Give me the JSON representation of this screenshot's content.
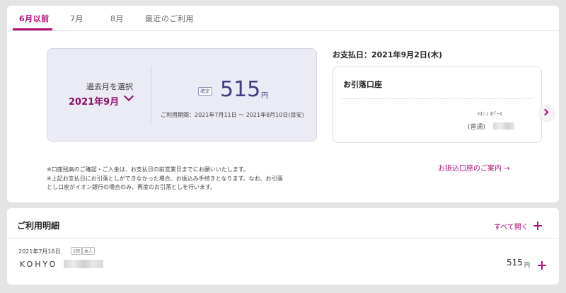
{
  "tabs": [
    {
      "label": "6月以前",
      "active": true
    },
    {
      "label": "7月",
      "active": false
    },
    {
      "label": "8月",
      "active": false
    },
    {
      "label": "最近のご利用",
      "active": false
    }
  ],
  "month_select": {
    "label": "過去月を選択",
    "value": "2021年9月"
  },
  "billing": {
    "badge": "確定",
    "amount": "515",
    "currency": "円",
    "period": "ご利用期間：2021年7月11日 ～ 2021年8月10日(目安)"
  },
  "payment": {
    "date": "お支払日：2021年9月2日(木)",
    "account_title": "お引落口座",
    "bank": "ｲｵﾝ / ｵﾊﾟｰﾙ",
    "account_type": "(普通)"
  },
  "notes": [
    "※口座残高のご確認・ご入金は、お支払日の前営業日までにお願いいたします。",
    "※上記お支払日にお引落としができなかった場合、お振込み手続きとなります。なお、お引落",
    "とし口座がイオン銀行の場合のみ、再度のお引落としを行います。"
  ],
  "transfer_link": "お振込口座のご案内 →",
  "details": {
    "title": "ご利用明細",
    "open_all": "すべて開く",
    "rows": [
      {
        "date": "2021年7月16日",
        "tag1": "1回",
        "tag2": "本人",
        "merchant": "KOHYO",
        "amount": "515",
        "currency": "円"
      }
    ]
  },
  "colors": {
    "accent": "#b0107a",
    "amount": "#3c3c80",
    "select_bg": "#ebebf5"
  }
}
